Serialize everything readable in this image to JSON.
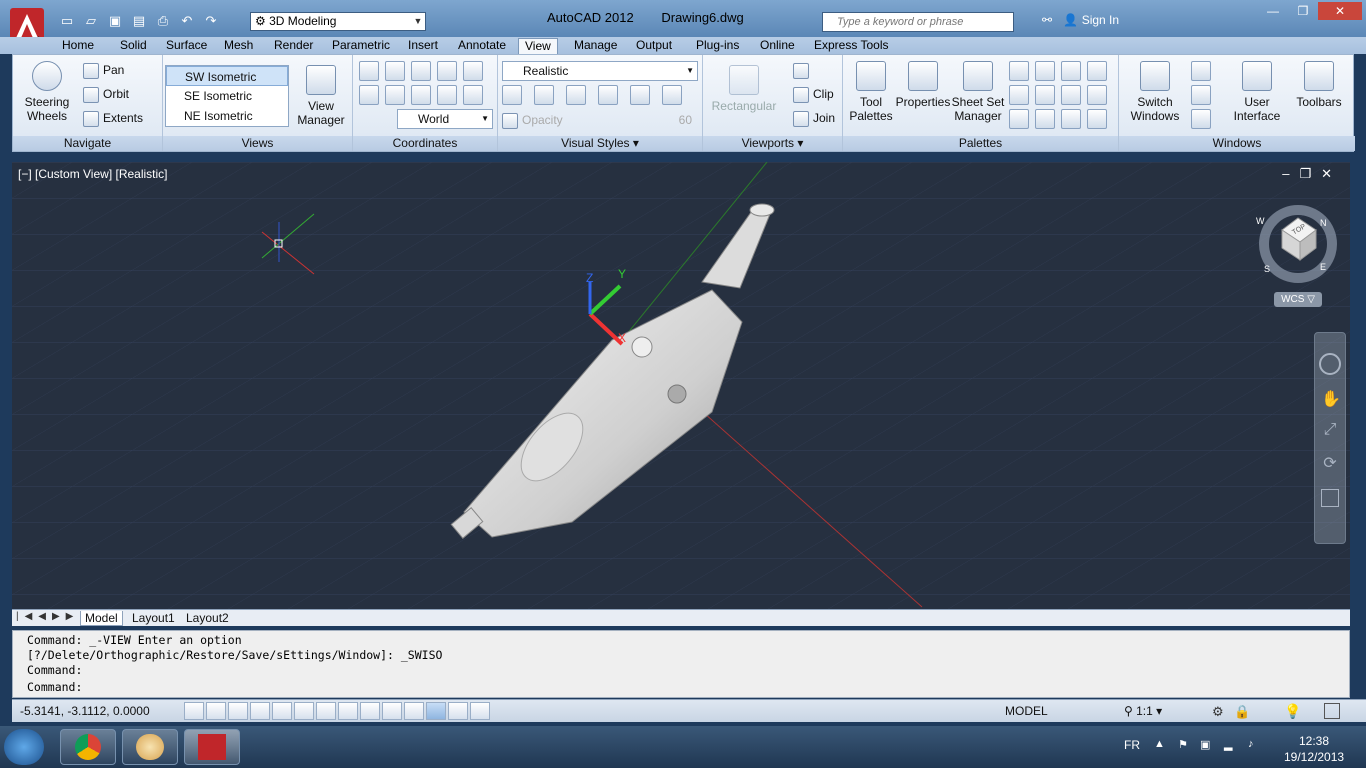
{
  "titlebar": {
    "workspace": "3D Modeling",
    "app_name": "AutoCAD 2012",
    "document": "Drawing6.dwg",
    "search_placeholder": "Type a keyword or phrase",
    "sign_in": "Sign In"
  },
  "ribbon_tabs": [
    "Home",
    "Solid",
    "Surface",
    "Mesh",
    "Render",
    "Parametric",
    "Insert",
    "Annotate",
    "View",
    "Manage",
    "Output",
    "Plug-ins",
    "Online",
    "Express Tools"
  ],
  "active_tab": "View",
  "navigate": {
    "label": "Navigate",
    "steering_wheels": "Steering Wheels",
    "pan": "Pan",
    "orbit": "Orbit",
    "extents": "Extents"
  },
  "views": {
    "label": "Views",
    "items": [
      "SW Isometric",
      "SE Isometric",
      "NE Isometric"
    ],
    "selected": "SW Isometric",
    "view_manager": "View Manager"
  },
  "coordinates": {
    "label": "Coordinates",
    "ucs": "World"
  },
  "visual_styles": {
    "label": "Visual Styles",
    "style": "Realistic",
    "opacity_label": "Opacity",
    "opacity_value": "60"
  },
  "viewports": {
    "label": "Viewports",
    "rectangular": "Rectangular",
    "clip": "Clip",
    "join": "Join"
  },
  "palettes": {
    "label": "Palettes",
    "tool_palettes": "Tool Palettes",
    "properties": "Properties",
    "sheet_set": "Sheet Set Manager"
  },
  "windows": {
    "label": "Windows",
    "switch_windows": "Switch Windows",
    "user_interface": "User Interface",
    "toolbars": "Toolbars"
  },
  "viewport": {
    "label": "[−] [Custom View] [Realistic]",
    "wcs": "WCS",
    "axis_x": "X",
    "axis_y": "Y",
    "axis_z": "Z",
    "viewcube_top": "TOP",
    "compass": [
      "W",
      "N",
      "S",
      "E"
    ]
  },
  "layout_tabs": [
    "Model",
    "Layout1",
    "Layout2"
  ],
  "active_layout": "Model",
  "command_lines": [
    "Command: _-VIEW Enter an option",
    "[?/Delete/Orthographic/Restore/Save/sEttings/Window]: _SWISO",
    "Command:"
  ],
  "command_prompt": "Command:",
  "status": {
    "coords": "-5.3141, -3.1112, 0.0000",
    "model": "MODEL",
    "scale": "1:1"
  },
  "taskbar": {
    "lang": "FR",
    "time": "12:38",
    "date": "19/12/2013"
  }
}
